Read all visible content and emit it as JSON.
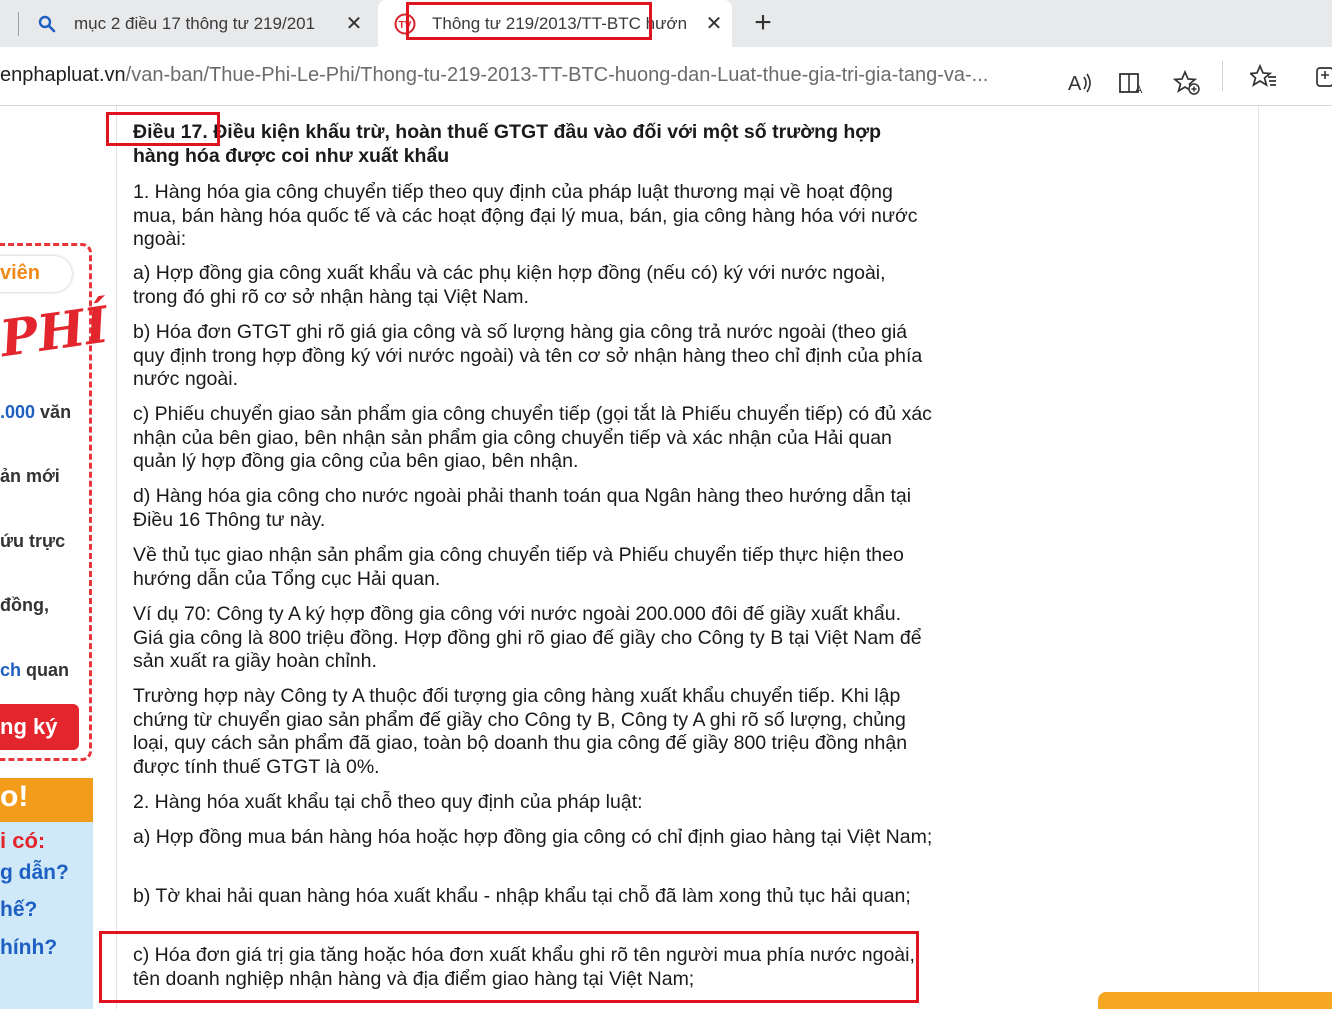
{
  "tabs": [
    {
      "title": "mục 2 điều 17 thông tư 219/201",
      "icon": "search-icon"
    },
    {
      "title": "Thông tư 219/2013/TT-BTC hướn",
      "icon": "site-favicon-icon"
    }
  ],
  "address_bar": {
    "host": "enphapluat.vn",
    "path": "/van-ban/Thue-Phi-Le-Phi/Thong-tu-219-2013-TT-BTC-huong-dan-Luat-thue-gia-tri-gia-tang-va-..."
  },
  "toolbar_icons": [
    "read-aloud-icon",
    "immersive-reader-icon",
    "add-favorite-icon",
    "favorites-icon",
    "collections-icon"
  ],
  "article": {
    "heading_number": "Điều 17.",
    "heading_text": " Điều kiện khấu trừ, hoàn thuế GTGT đầu vào đối với một số trường hợp hàng hóa được coi như xuất khẩu",
    "paragraphs": [
      "1. Hàng hóa gia công chuyển tiếp theo quy định của pháp luật thương mại về hoạt động mua, bán hàng hóa quốc tế và các hoạt động đại lý mua, bán, gia công hàng hóa với nước ngoài:",
      "a) Hợp đồng gia công xuất khẩu và các phụ kiện hợp đồng (nếu có) ký với nước ngoài, trong đó ghi rõ cơ sở nhận hàng tại Việt Nam.",
      "b) Hóa đơn GTGT ghi rõ giá gia công và số lượng hàng gia công trả nước ngoài (theo giá quy định trong hợp đồng ký với nước ngoài) và tên cơ sở nhận hàng theo chỉ định của phía nước ngoài.",
      "c) Phiếu chuyển giao sản phẩm gia công chuyển tiếp (gọi tắt là Phiếu chuyển tiếp) có đủ xác nhận của bên giao, bên nhận sản phẩm gia công chuyển tiếp và xác nhận của Hải quan quản lý hợp đồng gia công của bên giao, bên nhận.",
      "d) Hàng hóa gia công cho nước ngoài phải thanh toán qua Ngân hàng theo hướng dẫn tại Điều 16 Thông tư này.",
      "Về thủ tục giao nhận sản phẩm gia công chuyển tiếp và Phiếu chuyển tiếp thực hiện theo hướng dẫn của Tổng cục Hải quan.",
      "Ví dụ 70: Công ty A ký hợp đồng gia công với nước ngoài 200.000 đôi đế giầy xuất khẩu. Giá gia công là 800 triệu đồng. Hợp đồng ghi rõ giao đế giầy cho Công ty B tại Việt Nam để sản xuất ra giầy hoàn chỉnh.",
      "Trường hợp này Công ty A thuộc đối tượng gia công hàng xuất khẩu chuyển tiếp. Khi lập chứng từ chuyển giao sản phẩm đế giầy cho Công ty B, Công ty A ghi rõ số lượng, chủng loại, quy cách sản phẩm đã giao, toàn bộ doanh thu gia công đế giầy 800 triệu đồng nhận được tính thuế GTGT là 0%.",
      "2. Hàng hóa xuất khẩu tại chỗ theo quy định của pháp luật:",
      "a) Hợp đồng mua bán hàng hóa hoặc hợp đồng gia công có chỉ định giao hàng tại Việt Nam;",
      "b) Tờ khai hải quan hàng hóa xuất khẩu - nhập khẩu tại chỗ đã làm xong thủ tục hải quan;",
      "c) Hóa đơn giá trị gia tăng hoặc hóa đơn xuất khẩu ghi rõ tên người mua phía nước ngoài, tên doanh nghiệp nhận hàng và địa điểm giao hàng tại Việt Nam;"
    ]
  },
  "left_ad": {
    "line1": "viên",
    "line2": "PHÍ",
    "line3_num": ".000",
    "line3_text": " văn",
    "line4": "ản mới",
    "line5": "ứu trực",
    "line6": "đồng,",
    "line7_a": "ch",
    "line7_b": " quan",
    "button": "ng ký",
    "box2_top": "o!",
    "box2_l1": "i có:",
    "box2_l2": "g dẫn?",
    "box2_l3": "hế?",
    "box2_l4": "hính?"
  },
  "colors": {
    "annotation_red": "#e0141e",
    "ad_red": "#e3262e",
    "ad_orange": "#f39b1b",
    "ad_blue": "#cfe9f9",
    "link_blue": "#1e5fc2"
  }
}
